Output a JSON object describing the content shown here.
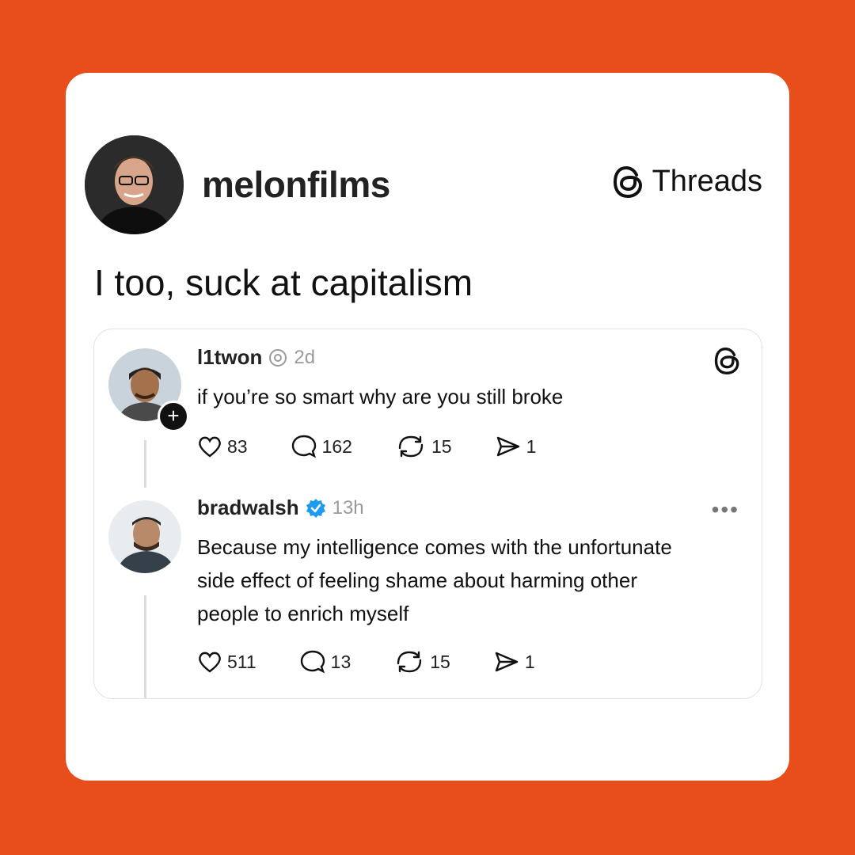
{
  "post": {
    "author": "melonfilms",
    "brand": "Threads",
    "caption": "I too, suck at capitalism"
  },
  "embed": {
    "reply1": {
      "username": "l1twon",
      "time": "2d",
      "text": "if you’re so smart why are you still broke",
      "likes": "83",
      "comments": "162",
      "reposts": "15",
      "shares": "1"
    },
    "reply2": {
      "username": "bradwalsh",
      "time": "13h",
      "text_lines": [
        "Because my intelligence comes with the unfortunate",
        "side effect of feeling shame about harming other",
        "people to enrich myself"
      ],
      "likes": "511",
      "comments": "13",
      "reposts": "15",
      "shares": "1",
      "more": "•••"
    }
  },
  "colors": {
    "background": "#e84e1b",
    "card": "#ffffff",
    "verified": "#1d9bf0"
  }
}
